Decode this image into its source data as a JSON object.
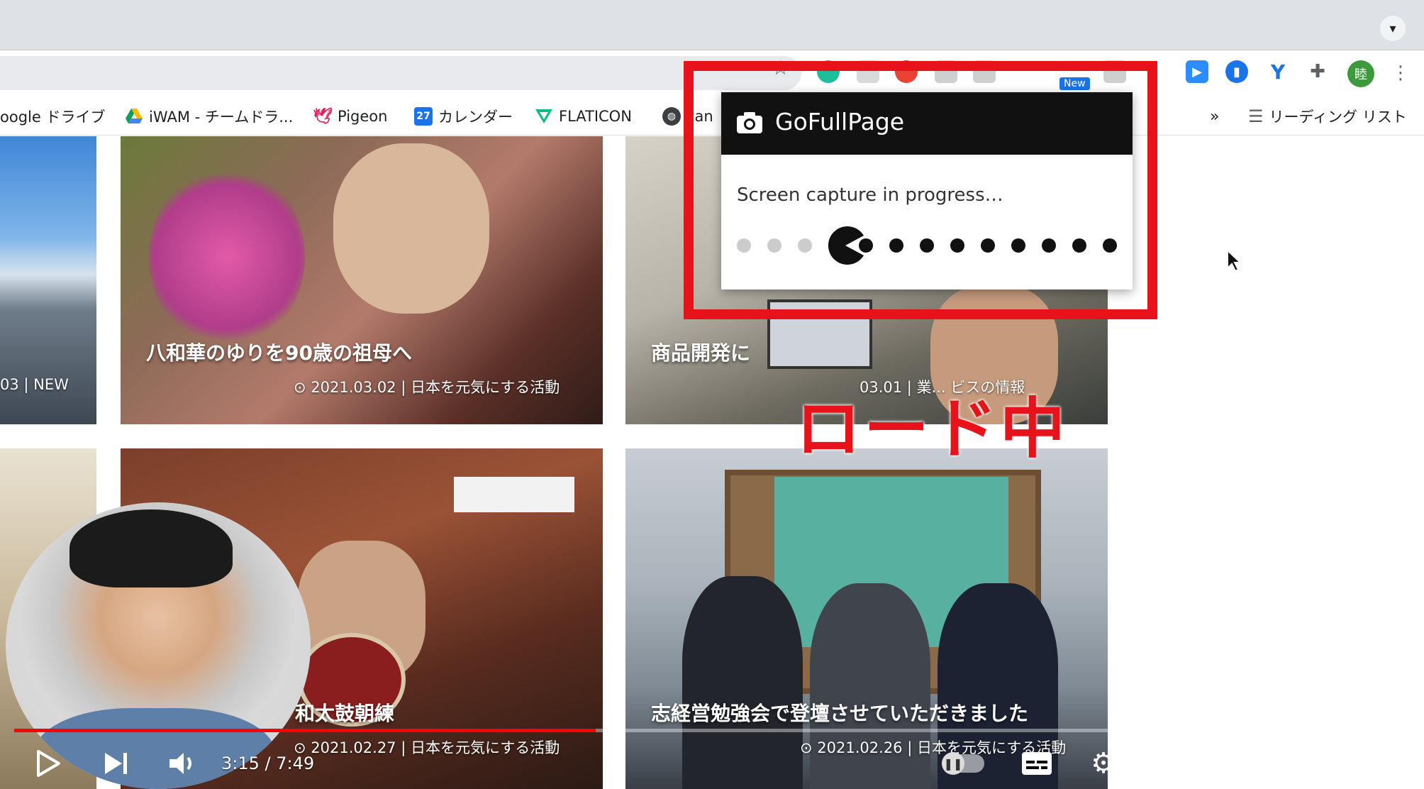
{
  "browser": {
    "avatar_label": "睦",
    "new_badge": "New",
    "bookmarks": [
      {
        "label": "oogle ドライブ",
        "icon": "drive-icon"
      },
      {
        "label": "iWAM - チームドラ...",
        "icon": "google-drive-icon"
      },
      {
        "label": "Pigeon",
        "icon": "pigeon-icon"
      },
      {
        "label": "カレンダー",
        "icon": "calendar-icon",
        "icon_text": "27"
      },
      {
        "label": "FLATICON",
        "icon": "flaticon-icon"
      },
      {
        "label": "can",
        "icon": "globe-icon"
      }
    ],
    "bookmarks_overflow": "»",
    "reading_list": "リーディング リスト"
  },
  "articles": [
    {
      "title": "八和華のゆりを90歳の祖母へ",
      "date": "2021.03.02",
      "category": "日本を元気にする活動"
    },
    {
      "title": "商品開発に",
      "date": "03.01",
      "category": "業... ビスの情報"
    },
    {
      "title": "和太鼓朝練",
      "date": "2021.02.27",
      "category": "日本を元気にする活動"
    },
    {
      "title": "志経営勉強会で登壇させていただきました",
      "date": "2021.02.26",
      "category": "日本を元気にする活動"
    }
  ],
  "partial_card": {
    "meta": "03",
    "tag": "NEW"
  },
  "popup": {
    "title": "GoFullPage",
    "status": "Screen capture in progress…",
    "progress_dots_total": 13,
    "progress_dots_done": 3
  },
  "annotation": {
    "label": "ロード中",
    "color": "#e8121b"
  },
  "video": {
    "current_time": "3:15",
    "separator": " / ",
    "duration": "7:49",
    "progress": 0.4166
  }
}
